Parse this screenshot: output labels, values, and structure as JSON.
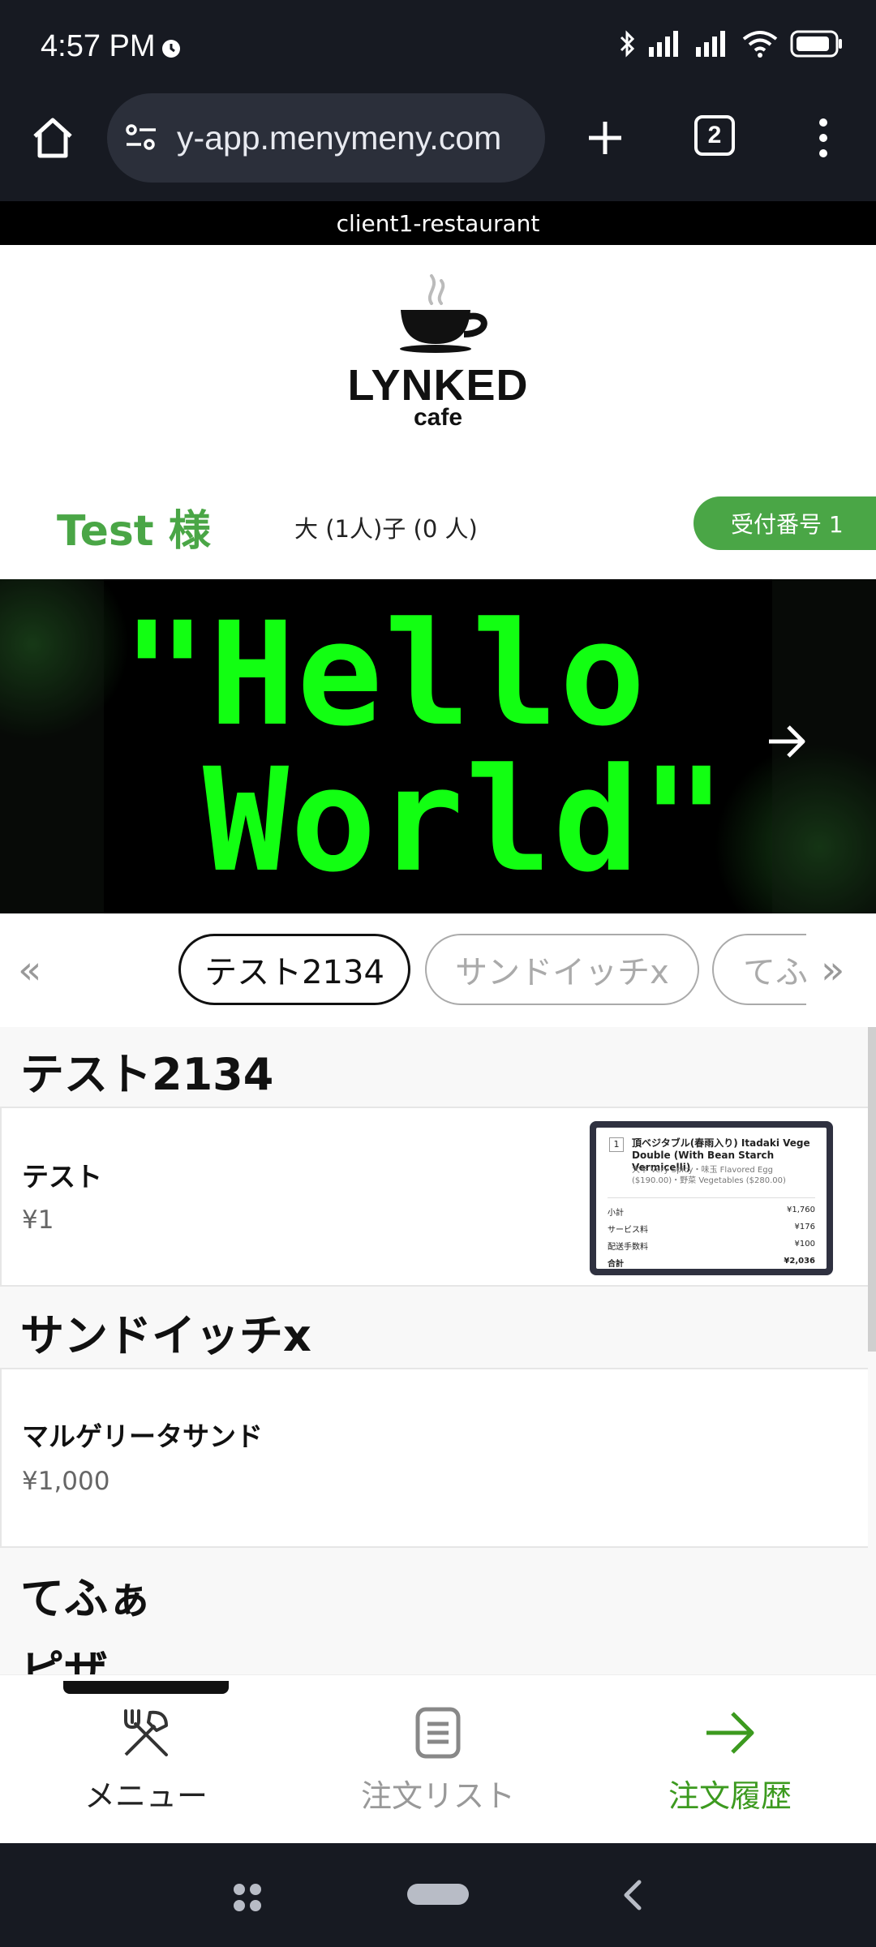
{
  "status_bar": {
    "time": "4:57 PM",
    "icons": [
      "alarm-icon",
      "bluetooth-icon",
      "signal-icon",
      "signal-icon",
      "wifi-icon",
      "battery-icon"
    ]
  },
  "browser": {
    "url": "y-app.menymeny.com",
    "tab_count": "2",
    "icons": [
      "home-icon",
      "site-settings-icon",
      "new-tab-icon",
      "tab-switcher-icon",
      "more-vert-icon"
    ]
  },
  "header": {
    "restaurant_id": "client1-restaurant",
    "logo_word": "LYNKED",
    "logo_sub": "cafe"
  },
  "guest": {
    "name": "Test 様",
    "party": "大 (1人)子 (0 人)",
    "reception": "受付番号 1"
  },
  "banner": {
    "line1": "\"Hello",
    "line2": "World\""
  },
  "categories": {
    "prev": "«",
    "next": "»",
    "tabs": [
      "テスト2134",
      "サンドイッチx",
      "てふぁ"
    ]
  },
  "menu": {
    "sections": [
      {
        "title": "テスト2134",
        "items": [
          {
            "name": "テスト",
            "price": "¥1",
            "thumb": {
              "qty": "1",
              "title": "頂ベジタブル(春雨入り) Itadaki Vege Double (With Bean Starch Vermicelli)",
              "detail": "大辛 Very Spicy・味玉 Flavored Egg ($190.00)・野菜 Vegetables ($280.00)",
              "rows": [
                {
                  "label": "小計",
                  "value": "¥1,760"
                },
                {
                  "label": "サービス料",
                  "value": "¥176"
                },
                {
                  "label": "配送手数料",
                  "value": "¥100"
                },
                {
                  "label": "合計",
                  "value": "¥2,036"
                }
              ]
            }
          }
        ]
      },
      {
        "title": "サンドイッチx",
        "items": [
          {
            "name": "マルゲリータサンド",
            "price": "¥1,000"
          }
        ]
      },
      {
        "title": "てふぁ",
        "items": []
      },
      {
        "title": "ピザ",
        "items": []
      }
    ]
  },
  "bottom_nav": {
    "items": [
      {
        "label": "メニュー",
        "icon": "fork-knife-icon"
      },
      {
        "label": "注文リスト",
        "icon": "order-list-icon"
      },
      {
        "label": "注文履歴",
        "icon": "arrow-right-icon"
      }
    ]
  },
  "colors": {
    "accent_green": "#4aa646",
    "banner_text": "#12ff12",
    "system_bar": "#171a22",
    "nav_history": "#3c9a1f"
  }
}
